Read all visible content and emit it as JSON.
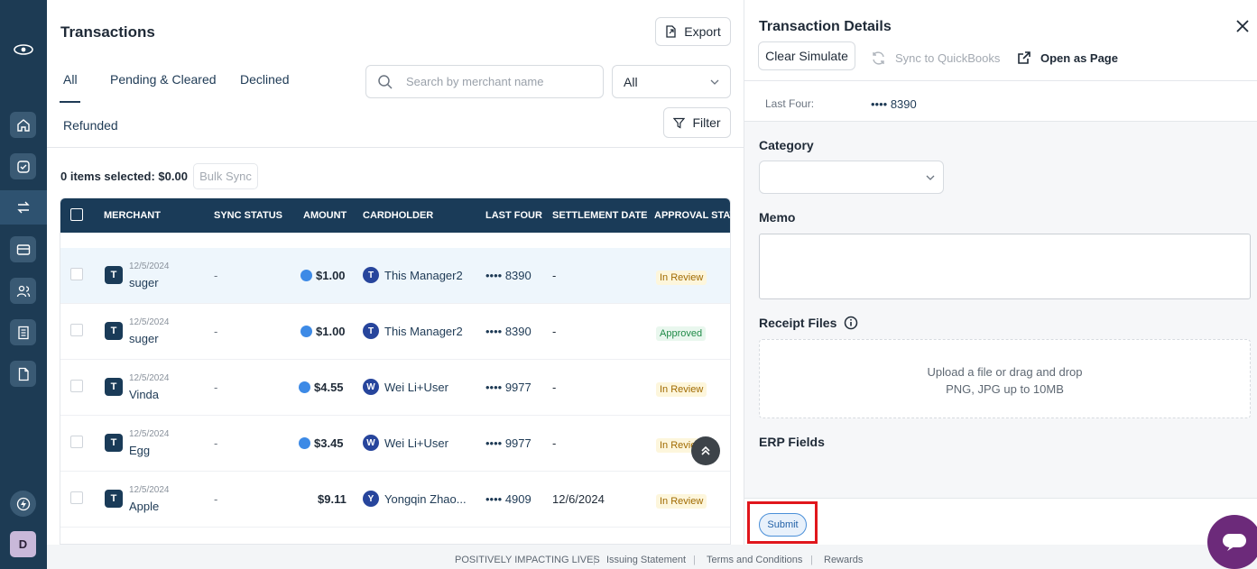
{
  "main": {
    "title": "Transactions",
    "export_label": "Export",
    "tabs": [
      {
        "label": "All"
      },
      {
        "label": "Pending & Cleared"
      },
      {
        "label": "Declined"
      },
      {
        "label": "Refunded"
      }
    ],
    "search_placeholder": "Search by merchant name",
    "status_select": "All",
    "filter_label": "Filter",
    "selection_summary": "0 items selected: $0.00",
    "bulk_sync_label": "Bulk Sync",
    "columns": [
      "MERCHANT",
      "SYNC STATUS",
      "AMOUNT",
      "CARDHOLDER",
      "LAST FOUR",
      "SETTLEMENT DATE",
      "APPROVAL STATU"
    ],
    "rows": [
      {
        "logo": "T",
        "date": "12/5/2024",
        "merchant": "suger",
        "sync": "-",
        "amount": "$1.00",
        "pending": true,
        "holder_initial": "T",
        "holder": "This Manager2",
        "last_four": "•••• 8390",
        "settlement": "-",
        "status": "In Review",
        "status_type": "review"
      },
      {
        "logo": "T",
        "date": "12/5/2024",
        "merchant": "suger",
        "sync": "-",
        "amount": "$1.00",
        "pending": true,
        "holder_initial": "T",
        "holder": "This Manager2",
        "last_four": "•••• 8390",
        "settlement": "-",
        "status": "Approved",
        "status_type": "approved"
      },
      {
        "logo": "T",
        "date": "12/5/2024",
        "merchant": "Vinda",
        "sync": "-",
        "amount": "$4.55",
        "pending": true,
        "holder_initial": "W",
        "holder": "Wei Li+User",
        "last_four": "•••• 9977",
        "settlement": "-",
        "status": "In Review",
        "status_type": "review"
      },
      {
        "logo": "T",
        "date": "12/5/2024",
        "merchant": "Egg",
        "sync": "-",
        "amount": "$3.45",
        "pending": true,
        "holder_initial": "W",
        "holder": "Wei Li+User",
        "last_four": "•••• 9977",
        "settlement": "-",
        "status": "In Revie",
        "status_type": "review"
      },
      {
        "logo": "T",
        "date": "12/5/2024",
        "merchant": "Apple",
        "sync": "-",
        "amount": "$9.11",
        "pending": false,
        "holder_initial": "Y",
        "holder": "Yongqin Zhao...",
        "last_four": "•••• 4909",
        "settlement": "12/6/2024",
        "status": "In Review",
        "status_type": "review"
      }
    ]
  },
  "panel": {
    "title": "Transaction Details",
    "clear_simulate": "Clear Simulate",
    "sync_quickbooks": "Sync to QuickBooks",
    "open_as_page": "Open as Page",
    "last_four_label": "Last Four:",
    "last_four_value": "•••• 8390",
    "category_label": "Category",
    "memo_label": "Memo",
    "receipt_label": "Receipt Files",
    "upload_line1": "Upload a file or drag and drop",
    "upload_line2": "PNG, JPG up to 10MB",
    "erp_label": "ERP Fields",
    "submit_label": "Submit"
  },
  "footer": {
    "links": [
      "POSITIVELY IMPACTING LIVES",
      "Issuing Statement",
      "Terms and Conditions",
      "Rewards"
    ]
  },
  "rail": {
    "avatar": "D",
    "icons": [
      "logo-icon",
      "home-icon",
      "tasks-icon",
      "transactions-icon",
      "cards-icon",
      "users-icon",
      "reports-icon",
      "documents-icon",
      "integrations-icon"
    ]
  },
  "colors": {
    "rail": "#1d3b54",
    "table_header": "#1a3b58",
    "submit_highlight": "#e0161c",
    "chat": "#6c2a7a"
  }
}
